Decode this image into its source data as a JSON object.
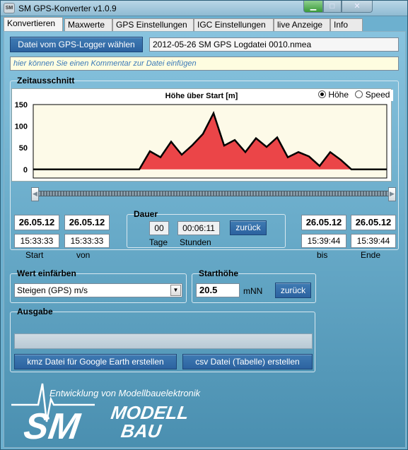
{
  "window": {
    "title": "SM GPS-Konverter v1.0.9",
    "icon_text": "SM"
  },
  "tabs": [
    {
      "label": "Konvertieren",
      "active": true
    },
    {
      "label": "Maxwerte"
    },
    {
      "label": "GPS Einstellungen"
    },
    {
      "label": "IGC Einstellungen"
    },
    {
      "label": "live Anzeige"
    },
    {
      "label": "Info"
    }
  ],
  "file": {
    "button_label": "Datei vom GPS-Logger wählen",
    "filename": "2012-05-26 SM GPS Logdatei 0010.nmea",
    "comment_placeholder": "hier können Sie einen Kommentar zur Datei einfügen"
  },
  "zeitausschnitt": {
    "title": "Zeitausschnitt",
    "radio_hoehe": "Höhe",
    "radio_speed": "Speed",
    "selected": "Höhe"
  },
  "chart_data": {
    "type": "area",
    "title": "Höhe über Start [m]",
    "ylim": [
      -20,
      150
    ],
    "y_ticks": [
      "150",
      "100",
      "50",
      "0"
    ],
    "x": [
      0,
      12,
      25,
      30,
      33,
      36,
      39,
      42,
      45,
      48,
      51,
      54,
      57,
      60,
      63,
      66,
      69,
      72,
      75,
      78,
      81,
      84,
      87,
      90,
      93,
      96,
      100
    ],
    "values": [
      0,
      0,
      0,
      0,
      42,
      28,
      64,
      34,
      56,
      82,
      130,
      55,
      68,
      40,
      72,
      52,
      74,
      28,
      40,
      30,
      8,
      40,
      22,
      0,
      0,
      0,
      0
    ],
    "colors": {
      "fill": "#e8252b",
      "line": "#000000",
      "plot_bg": "#fdfae8"
    }
  },
  "time": {
    "start_date": "26.05.12",
    "start_time": "15:33:33",
    "start_label": "Start",
    "von_date": "26.05.12",
    "von_time": "15:33:33",
    "von_label": "von",
    "dauer_title": "Dauer",
    "dauer_days": "00",
    "dauer_time": "00:06:11",
    "tage_label": "Tage",
    "stunden_label": "Stunden",
    "zurueck_label": "zurück",
    "bis_date": "26.05.12",
    "bis_time": "15:39:44",
    "bis_label": "bis",
    "ende_date": "26.05.12",
    "ende_time": "15:39:44",
    "ende_label": "Ende"
  },
  "farbe": {
    "title": "Wert einfärben",
    "selected": "Steigen (GPS) m/s"
  },
  "starthoehe": {
    "title": "Starthöhe",
    "value": "20.5",
    "unit": "mNN",
    "zurueck_label": "zurück"
  },
  "ausgabe": {
    "title": "Ausgabe",
    "kmz_button": "kmz Datei für Google Earth erstellen",
    "csv_button": "csv Datei (Tabelle) erstellen"
  },
  "logo": {
    "tagline": "Entwicklung von Modellbauelektronik",
    "brand_sm": "SM",
    "brand_modell": "MODELL",
    "brand_bau": "BAU"
  }
}
